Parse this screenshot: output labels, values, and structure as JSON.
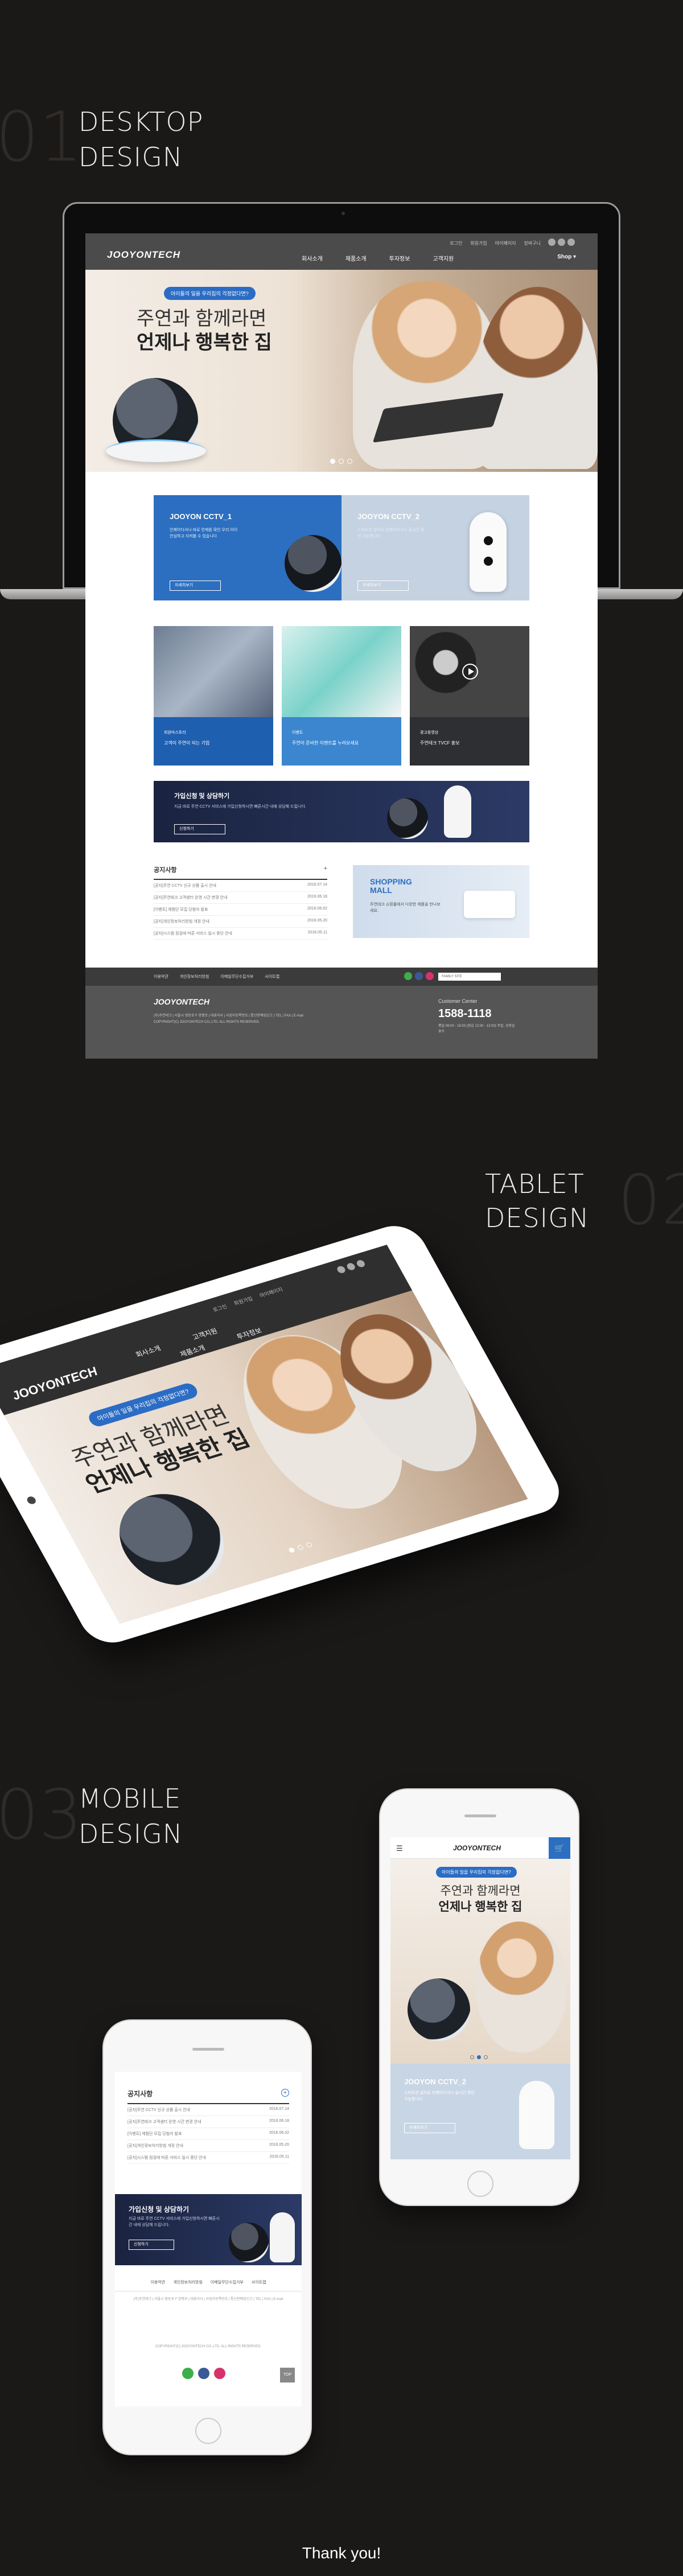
{
  "sections": {
    "desktop": {
      "num": "01",
      "title1": "DESKTOP",
      "title2": "DESIGN"
    },
    "tablet": {
      "num": "02",
      "title1": "TABLET",
      "title2": "DESIGN"
    },
    "mobile": {
      "num": "03",
      "title1": "MOBILE",
      "title2": "DESIGN"
    }
  },
  "site": {
    "logo": "JOOYONTECH",
    "util_links": [
      "로그인",
      "회원가입",
      "마이페이지",
      "장바구니"
    ],
    "nav": [
      "회사소개",
      "제품소개",
      "투자정보",
      "고객지원"
    ],
    "shop_label": "Shop",
    "hero": {
      "badge": "아이들의 일을 우리집의 걱정없다면?",
      "line1": "주연과 함께라면",
      "line2": "언제나 행복한 집"
    },
    "cctv1": {
      "title": "JOOYON CCTV_1",
      "desc": "언제어디서나 바로 언제를 확인 우리 아이 안심하고 지켜볼 수 있습니다",
      "button": "자세히보기"
    },
    "cctv2": {
      "title": "JOOYON CCTV_2",
      "desc": "스마트한 설치로 언제어디서나 실시간 확인 가능합니다",
      "button": "자세히보기"
    },
    "tiles": [
      {
        "title": "회원마스토리",
        "desc": "고객이 주연이 되는 기업"
      },
      {
        "title": "이벤트",
        "desc": "주연이 준비한 이벤트를 누려보세요"
      },
      {
        "title": "광고동영상",
        "desc": "주연테크 TVCF 홍보"
      }
    ],
    "consult": {
      "title": "가입신청 및 상담하기",
      "desc": "지금 바로 주연 CCTV 서비스에 가입신청하시면 빠른시간 내에 상담해 드립니다.",
      "button": "신청하기"
    },
    "notice": {
      "title": "공지사항",
      "plus": "+",
      "rows": [
        {
          "text": "[공지]주연 CCTV 신규 상품 출시 안내",
          "date": "2016.07.14"
        },
        {
          "text": "[공지]주연테크 고객센터 운영 시간 변경 안내",
          "date": "2016.06.18"
        },
        {
          "text": "[이벤트] 체험단 모집 당첨자 발표",
          "date": "2016.06.02"
        },
        {
          "text": "[공지]개인정보처리방침 개정 안내",
          "date": "2016.05.20"
        },
        {
          "text": "[공지]시스템 점검에 따른 서비스 일시 중단 안내",
          "date": "2016.05.11"
        }
      ]
    },
    "shopping": {
      "title1": "SHOPPING",
      "title2": "MALL",
      "desc": "주연테크 쇼핑몰에서 다양한 제품을 만나보세요."
    },
    "footer": {
      "links": [
        "이용약관",
        "개인정보처리방침",
        "이메일무단수집거부",
        "사이트맵"
      ],
      "family_site": "FAMILY SITE",
      "logo": "JOOYONTECH",
      "address": "(주)주연테크 | 서울시 영등포구 양평로 | 대표이사 | 사업자등록번호 | 통신판매업신고 | TEL | FAX | E-mail",
      "copyright": "COPYRIGHT(C) JOOYONTECH CO.,LTD. ALL RIGHTS RESERVED.",
      "cc_label": "Customer Center",
      "phone": "1588-1118",
      "hours": "평일 09:00 - 18:00 (점심 12:00 - 13:00) 주말, 공휴일 휴무"
    }
  },
  "mobile_right": {
    "menu_icon": "☰",
    "cart_icon": "🛒"
  },
  "mobile_left": {
    "top_label": "TOP"
  },
  "thanks": "Thank you!",
  "colors": {
    "background": "#1b1918",
    "brand_blue": "#2c6fc0",
    "header_gray": "#4b4b4b"
  },
  "icons": [
    "menu-icon",
    "cart-icon",
    "facebook-icon",
    "instagram-icon",
    "blog-icon",
    "play-icon",
    "plus-icon",
    "chevron-down-icon"
  ]
}
